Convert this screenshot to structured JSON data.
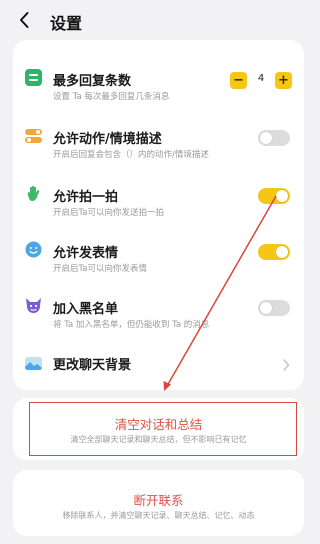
{
  "header": {
    "title": "设置"
  },
  "settings": {
    "max_reply": {
      "label": "最多回复条数",
      "desc": "设置 Ta 每次最多回复几条消息",
      "value": "4",
      "minus": "−",
      "plus": "+",
      "icon": "chat-list-icon"
    },
    "allow_action": {
      "label": "允许动作/情境描述",
      "desc": "开启后回复会包含（）内的动作/情境描述",
      "on": false,
      "icon": "toggle-switch-icon"
    },
    "allow_pat": {
      "label": "允许拍一拍",
      "desc": "开启后Ta可以向你发送拍一拍",
      "on": true,
      "icon": "waving-hand-icon"
    },
    "allow_sticker": {
      "label": "允许发表情",
      "desc": "开启后Ta可以向你发表情",
      "on": true,
      "icon": "smiley-face-icon"
    },
    "blacklist": {
      "label": "加入黑名单",
      "desc": "将 Ta 加入黑名单，但仍能收到 Ta 的消息",
      "on": false,
      "icon": "devil-face-icon"
    },
    "chat_bg": {
      "label": "更改聊天背景",
      "icon": "landscape-image-icon"
    }
  },
  "clear": {
    "title": "清空对话和总结",
    "desc": "清空全部聊天记录和聊天总结，但不影响已有记忆"
  },
  "disconnect": {
    "title": "断开联系",
    "desc": "移除联系人，并清空聊天记录、聊天总结、记忆、动态"
  },
  "colors": {
    "accent": "#f6c516",
    "danger": "#e0524a",
    "annotation": "#d9463b",
    "background": "#f2f2f4"
  }
}
